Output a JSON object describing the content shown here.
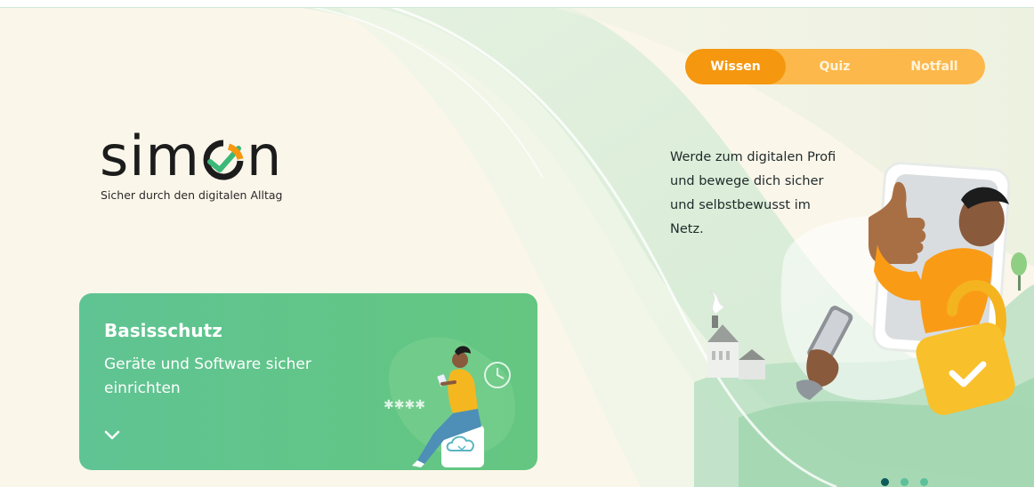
{
  "nav": {
    "tabs": [
      {
        "label": "Wissen",
        "active": true
      },
      {
        "label": "Quiz",
        "active": false
      },
      {
        "label": "Notfall",
        "active": false
      }
    ]
  },
  "logo": {
    "text_left": "sim",
    "text_right": "n",
    "tagline": "Sicher durch den digitalen Alltag"
  },
  "hero": {
    "lines": [
      "Werde zum digitalen Profi",
      "und bewege dich sicher",
      "und selbstbewusst im",
      "Netz."
    ]
  },
  "card": {
    "title": "Basisschutz",
    "subtitle_lines": [
      "Geräte und Software sicher",
      "einrichten"
    ]
  },
  "carousel": {
    "total": 3,
    "active_index": 0
  },
  "colors": {
    "accent_orange": "#f5970f",
    "nav_bg": "#fcb84a",
    "card_green": "#62c58a",
    "dot_active": "#0f5a5a",
    "dot_inactive": "#5cc09a"
  }
}
